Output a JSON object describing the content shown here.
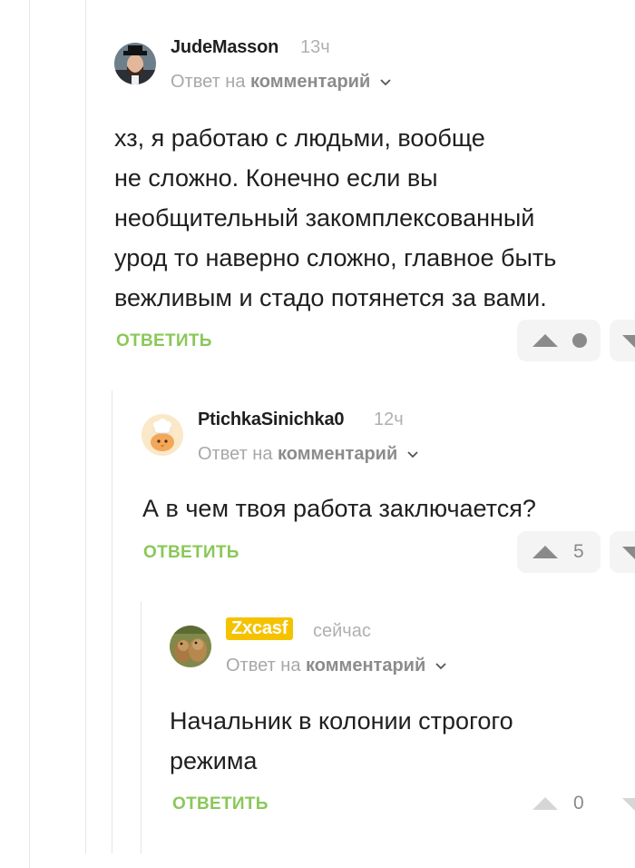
{
  "comments": [
    {
      "username": "JudeMasson",
      "time": "13ч",
      "reply_prefix": "Ответ на",
      "reply_target": "комментарий",
      "text_lines": [
        "хз, я работаю с людьми, вообще",
        "не сложно. Конечно если вы",
        "необщительный закомплексованный",
        "урод то наверно сложно, главное быть",
        "вежливым и стадо потянется за вами."
      ],
      "reply_label": "ОТВЕТИТЬ",
      "score": ""
    },
    {
      "username": "PtichkaSinichka0",
      "time": "12ч",
      "reply_prefix": "Ответ на",
      "reply_target": "комментарий",
      "text_lines": [
        "А в чем твоя работа заключается?"
      ],
      "reply_label": "ОТВЕТИТЬ",
      "score": "5"
    },
    {
      "username": "Zxcasf",
      "time": "сейчас",
      "reply_prefix": "Ответ на",
      "reply_target": "комментарий",
      "text_lines": [
        "Начальник в колонии строгого",
        "режима"
      ],
      "reply_label": "ОТВЕТИТЬ",
      "score": "0"
    }
  ],
  "colors": {
    "reply_green": "#8ac858",
    "highlight_yellow": "#f5c200",
    "muted_gray": "#a8a8a8"
  },
  "icons": [
    "avatar",
    "chevron-down-icon",
    "upvote-arrow-icon",
    "downvote-arrow-icon",
    "score-dot-icon"
  ]
}
